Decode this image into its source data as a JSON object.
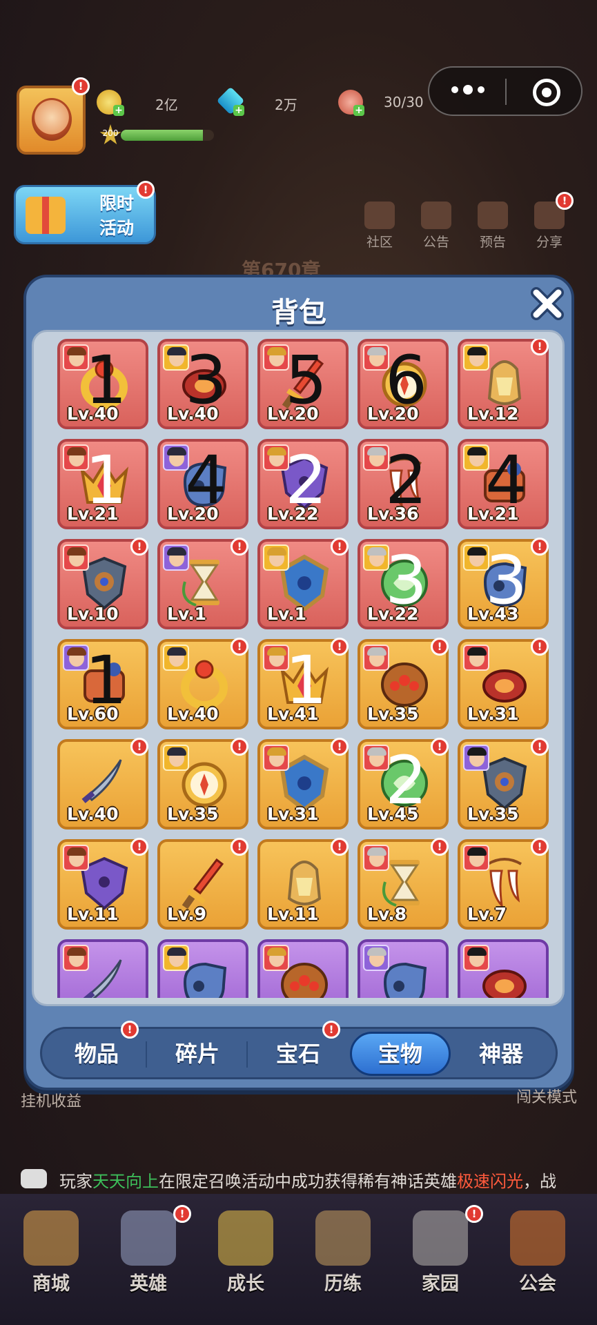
{
  "topbar": {
    "gold": "2亿",
    "gems": "2万",
    "stamina": "30/30",
    "player_level": "200",
    "xp_progress": 0.88
  },
  "event_button": {
    "line1": "限时",
    "line2": "活动"
  },
  "top_nav": [
    {
      "label": "社区",
      "icon": "house-icon"
    },
    {
      "label": "公告",
      "icon": "megaphone-icon"
    },
    {
      "label": "预告",
      "icon": "notice-icon"
    },
    {
      "label": "分享",
      "icon": "share-icon"
    }
  ],
  "chapter_text": "第670章",
  "modal": {
    "title": "背包",
    "close_symbol": "✕",
    "items": [
      {
        "rarity": "red",
        "level": "Lv.40",
        "hero": "r",
        "item": "ring",
        "alert": false
      },
      {
        "rarity": "red",
        "level": "Lv.40",
        "hero": "y",
        "item": "ringred",
        "alert": false
      },
      {
        "rarity": "red",
        "level": "Lv.20",
        "hero": "r",
        "item": "dagger",
        "alert": false
      },
      {
        "rarity": "red",
        "level": "Lv.20",
        "hero": "r",
        "item": "compass",
        "alert": false
      },
      {
        "rarity": "red",
        "level": "Lv.12",
        "hero": "y",
        "item": "lantern",
        "alert": true
      },
      {
        "rarity": "red",
        "level": "Lv.21",
        "hero": "r",
        "item": "crown",
        "alert": false
      },
      {
        "rarity": "red",
        "level": "Lv.20",
        "hero": "p",
        "item": "whistle",
        "alert": false
      },
      {
        "rarity": "red",
        "level": "Lv.22",
        "hero": "r",
        "item": "shieldp",
        "alert": false
      },
      {
        "rarity": "red",
        "level": "Lv.36",
        "hero": "r",
        "item": "fang",
        "alert": false
      },
      {
        "rarity": "red",
        "level": "Lv.21",
        "hero": "y",
        "item": "scroll",
        "alert": false
      },
      {
        "rarity": "red",
        "level": "Lv.10",
        "hero": "r",
        "item": "shield",
        "alert": true
      },
      {
        "rarity": "red",
        "level": "Lv.1",
        "hero": "p",
        "item": "hourglass",
        "alert": true
      },
      {
        "rarity": "red",
        "level": "Lv.1",
        "hero": "y",
        "item": "shieldb",
        "alert": true
      },
      {
        "rarity": "red",
        "level": "Lv.22",
        "hero": "y",
        "item": "orb",
        "alert": false
      },
      {
        "rarity": "orange",
        "level": "Lv.43",
        "hero": "y",
        "item": "whistle",
        "alert": true
      },
      {
        "rarity": "orange",
        "level": "Lv.60",
        "hero": "p",
        "item": "scroll",
        "alert": false
      },
      {
        "rarity": "orange",
        "level": "Lv.40",
        "hero": "y",
        "item": "ring",
        "alert": true
      },
      {
        "rarity": "orange",
        "level": "Lv.41",
        "hero": "r",
        "item": "crown",
        "alert": true
      },
      {
        "rarity": "orange",
        "level": "Lv.35",
        "hero": "r",
        "item": "helm",
        "alert": true
      },
      {
        "rarity": "orange",
        "level": "Lv.31",
        "hero": "r",
        "item": "ringred",
        "alert": true
      },
      {
        "rarity": "orange",
        "level": "Lv.40",
        "hero": "",
        "item": "sword",
        "alert": true
      },
      {
        "rarity": "orange",
        "level": "Lv.35",
        "hero": "y",
        "item": "compass",
        "alert": true
      },
      {
        "rarity": "orange",
        "level": "Lv.31",
        "hero": "r",
        "item": "shieldb",
        "alert": true
      },
      {
        "rarity": "orange",
        "level": "Lv.45",
        "hero": "r",
        "item": "orb",
        "alert": true
      },
      {
        "rarity": "orange",
        "level": "Lv.35",
        "hero": "p",
        "item": "shield",
        "alert": true
      },
      {
        "rarity": "orange",
        "level": "Lv.11",
        "hero": "r",
        "item": "shieldp",
        "alert": true
      },
      {
        "rarity": "orange",
        "level": "Lv.9",
        "hero": "",
        "item": "dagger",
        "alert": true
      },
      {
        "rarity": "orange",
        "level": "Lv.11",
        "hero": "",
        "item": "lantern",
        "alert": true
      },
      {
        "rarity": "orange",
        "level": "Lv.8",
        "hero": "r",
        "item": "hourglass",
        "alert": true
      },
      {
        "rarity": "orange",
        "level": "Lv.7",
        "hero": "r",
        "item": "fang",
        "alert": true
      },
      {
        "rarity": "purple",
        "level": "",
        "hero": "r",
        "item": "sword",
        "alert": false
      },
      {
        "rarity": "purple",
        "level": "",
        "hero": "y",
        "item": "whistle",
        "alert": false
      },
      {
        "rarity": "purple",
        "level": "",
        "hero": "r",
        "item": "helm",
        "alert": false
      },
      {
        "rarity": "purple",
        "level": "",
        "hero": "p",
        "item": "whistle",
        "alert": false
      },
      {
        "rarity": "purple",
        "level": "",
        "hero": "r",
        "item": "ringred",
        "alert": false
      }
    ],
    "handwritten_marks": [
      {
        "cell": 0,
        "text": "1",
        "color": "black"
      },
      {
        "cell": 1,
        "text": "3",
        "color": "black"
      },
      {
        "cell": 2,
        "text": "5",
        "color": "black"
      },
      {
        "cell": 3,
        "text": "6",
        "color": "black"
      },
      {
        "cell": 5,
        "text": "1",
        "color": "white"
      },
      {
        "cell": 6,
        "text": "4",
        "color": "black"
      },
      {
        "cell": 7,
        "text": "2",
        "color": "white"
      },
      {
        "cell": 8,
        "text": "2",
        "color": "black"
      },
      {
        "cell": 9,
        "text": "4",
        "color": "black"
      },
      {
        "cell": 13,
        "text": "3",
        "color": "white"
      },
      {
        "cell": 14,
        "text": "3",
        "color": "white"
      },
      {
        "cell": 15,
        "text": "1",
        "color": "black"
      },
      {
        "cell": 17,
        "text": "1",
        "color": "white"
      },
      {
        "cell": 23,
        "text": "2",
        "color": "white"
      }
    ],
    "tabs": [
      {
        "label": "物品",
        "alert": true,
        "active": false
      },
      {
        "label": "碎片",
        "alert": false,
        "active": false
      },
      {
        "label": "宝石",
        "alert": true,
        "active": false
      },
      {
        "label": "宝物",
        "alert": false,
        "active": true
      },
      {
        "label": "神器",
        "alert": false,
        "active": false
      }
    ]
  },
  "side_labels": {
    "left": "挂机收益",
    "right": "闯关模式"
  },
  "ticker": {
    "prefix": "玩家",
    "player": "天天向上",
    "middle": "在限定召唤活动中成功获得稀有神话英雄",
    "hero": "极速闪光",
    "suffix": "，战"
  },
  "bottom_nav": [
    {
      "label": "商城",
      "alert": false,
      "color": "#e6a84a"
    },
    {
      "label": "英雄",
      "alert": true,
      "color": "#9aa6c8"
    },
    {
      "label": "成长",
      "alert": false,
      "color": "#e9c24a"
    },
    {
      "label": "历练",
      "alert": false,
      "color": "#c9a060"
    },
    {
      "label": "家园",
      "alert": true,
      "color": "#b8b4b0"
    },
    {
      "label": "公会",
      "alert": false,
      "color": "#e07a2e"
    }
  ],
  "colors": {
    "modal_bg": "#5f83b4",
    "red_tile": "#e06e68",
    "orange_tile": "#f1b44a",
    "purple_tile": "#b07be0",
    "alert": "#e13a32"
  }
}
